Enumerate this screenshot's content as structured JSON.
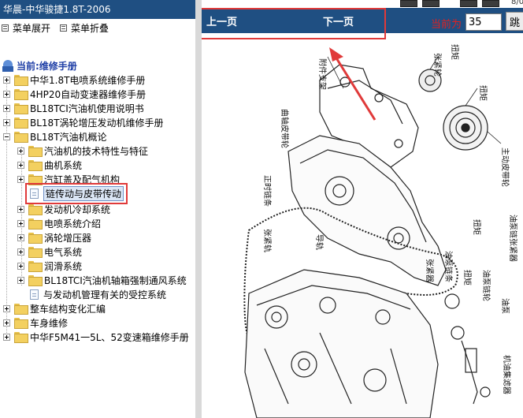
{
  "app": {
    "title": "华晨-中华骏捷1.8T-2006"
  },
  "menu": {
    "expand": "菜单展开",
    "collapse": "菜单折叠"
  },
  "tree": {
    "root": "当前:维修手册",
    "items": [
      "中华1.8T电喷系统维修手册",
      "4HP20自动变速器维修手册",
      "BL18TCI汽油机使用说明书",
      "BL18T涡轮增压发动机维修手册",
      "BL18T汽油机概论",
      "汽油机的技术特性与特征",
      "曲机系统",
      "汽缸盖及配气机构",
      "链传动与皮带传动",
      "发动机冷却系统",
      "电喷系统介绍",
      "涡轮增压器",
      "电气系统",
      "润滑系统",
      "BL18TCI汽油机轴箱强制通风系统",
      "与发动机管理有关的受控系统",
      "整车结构变化汇编",
      "车身维修",
      "中华F5M41一5L、52变速箱维修手册"
    ]
  },
  "nav": {
    "prev": "上一页",
    "next": "下一页",
    "current_label": "当前为",
    "page": "35",
    "jump": "跳",
    "toolbar_extra": "8/0"
  },
  "diagram": {
    "labels": [
      "附件支架",
      "张紧轮",
      "扭矩",
      "扭矩",
      "曲轴皮带轮",
      "主动皮带轮",
      "正时链条",
      "导轨",
      "张紧轨",
      "扭矩",
      "油泵链张紧器",
      "张紧器",
      "油泵链条",
      "油泵",
      "扭矩",
      "油泵链轮",
      "机油集滤器"
    ]
  }
}
